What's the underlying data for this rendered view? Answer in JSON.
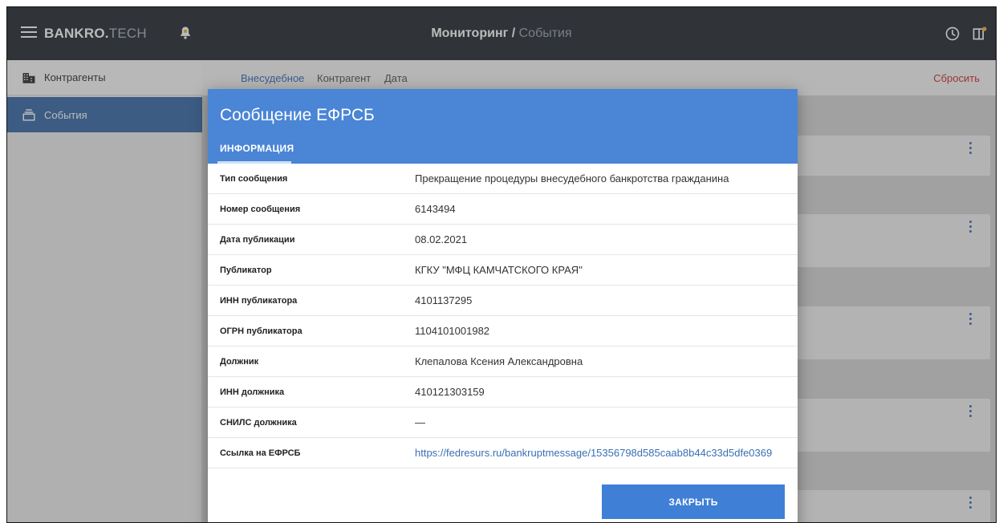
{
  "topbar": {
    "brand_main": "BANKRO.",
    "brand_suffix": "TECH",
    "title_main": "Мониторинг",
    "title_separator": " / ",
    "title_sub": "События",
    "icons": [
      "menu-icon",
      "bell-icon",
      "clock-icon",
      "panel-icon"
    ]
  },
  "sidebar": {
    "items": [
      {
        "label": "Контрагенты",
        "icon": "building-icon"
      },
      {
        "label": "События",
        "icon": "events-icon"
      }
    ]
  },
  "filters": {
    "items": [
      "Внесудебное",
      "Контрагент",
      "Дата"
    ],
    "reset_label": "Сбросить"
  },
  "modal": {
    "title": "Сообщение ЕФРСБ",
    "tab_label": "ИНФОРМАЦИЯ",
    "rows": [
      {
        "key": "Тип сообщения",
        "value": "Прекращение процедуры внесудебного банкротства гражданина"
      },
      {
        "key": "Номер сообщения",
        "value": "6143494"
      },
      {
        "key": "Дата публикации",
        "value": "08.02.2021"
      },
      {
        "key": "Публикатор",
        "value": "КГКУ \"МФЦ КАМЧАТСКОГО КРАЯ\""
      },
      {
        "key": "ИНН публикатора",
        "value": "4101137295"
      },
      {
        "key": "ОГРН публикатора",
        "value": "1104101001982"
      },
      {
        "key": "Должник",
        "value": "Клепалова Ксения Александровна"
      },
      {
        "key": "ИНН должника",
        "value": "410121303159"
      },
      {
        "key": "СНИЛС должника",
        "value": "—"
      },
      {
        "key": "Ссылка на ЕФРСБ",
        "value": "https://fedresurs.ru/bankruptmessage/15356798d585caab8b44c33d5dfe0369"
      }
    ],
    "close_label": "ЗАКРЫТЬ"
  },
  "colors": {
    "topbar": "#2a2f37",
    "sidebar_active": "#3d6ea9",
    "modal_header": "#4a85d6",
    "button": "#3f7fd6",
    "link": "#3a6fb4",
    "reset": "#d03232"
  }
}
